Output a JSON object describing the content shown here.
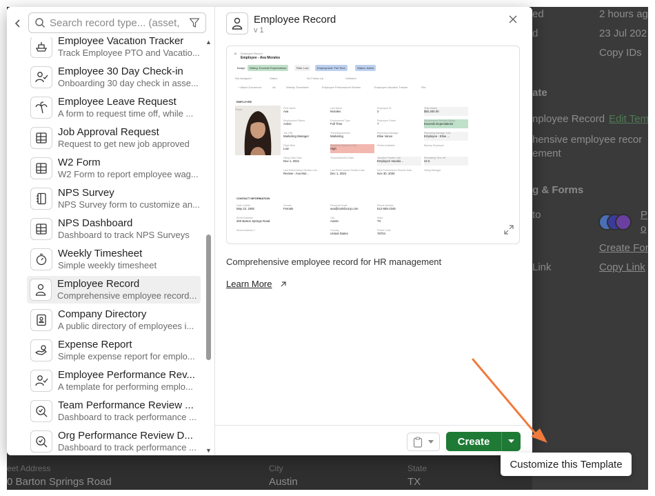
{
  "background": {
    "right_values": [
      "2 hours ag",
      "23 Jul 202",
      "Copy IDs"
    ],
    "left_fragments": [
      "ed",
      "d"
    ],
    "template_heading": "ate",
    "template_name": "nployee Record",
    "edit_link": "Edit Tem",
    "template_desc_line1": "hensive employee recor",
    "template_desc_line2": "ement",
    "section_heading": "g & Forms",
    "to_label": "to",
    "owner_link_p": "P",
    "owner_link_o": "o",
    "create_form_link": "Create For",
    "link_label": "Link",
    "copy_link": "Copy Link",
    "street_label": "eet Address",
    "street_value": "0 Barton Springs Road",
    "city_label": "City",
    "city_value": "Austin",
    "state_label": "State",
    "state_value": "TX",
    "avatar_colors": [
      "#4a6fb5",
      "#6b3fa0",
      "#3b3b9c"
    ]
  },
  "search": {
    "placeholder": "Search record type... (asset, p"
  },
  "templates": [
    {
      "name": "Employee Vacation Tracker",
      "desc": "Track Employee PTO and Vacatio...",
      "icon": "ship-icon"
    },
    {
      "name": "Employee 30 Day Check-in",
      "desc": "Onboarding 30 day check in asse...",
      "icon": "user-check-icon"
    },
    {
      "name": "Employee Leave Request",
      "desc": "A form to request time off, while ...",
      "icon": "palm-tree-icon"
    },
    {
      "name": "Job Approval Request",
      "desc": "Request to get new job approved",
      "icon": "table-grid-icon"
    },
    {
      "name": "W2 Form",
      "desc": "W2 Form to report employee wag...",
      "icon": "table-grid-icon"
    },
    {
      "name": "NPS Survey",
      "desc": "NPS Survey form to customize an...",
      "icon": "notebook-icon"
    },
    {
      "name": "NPS Dashboard",
      "desc": "Dashboard to track NPS Surveys",
      "icon": "table-grid-icon"
    },
    {
      "name": "Weekly Timesheet",
      "desc": "Simple weekly timesheet",
      "icon": "timer-icon"
    },
    {
      "name": "Employee Record",
      "desc": "Comprehensive employee record...",
      "icon": "user-icon"
    },
    {
      "name": "Company Directory",
      "desc": "A public directory of employees i...",
      "icon": "contact-book-icon"
    },
    {
      "name": "Expense Report",
      "desc": "Simple expense report for emplo...",
      "icon": "hand-coins-icon"
    },
    {
      "name": "Employee Performance Rev...",
      "desc": "A template for performing emplo...",
      "icon": "user-check-icon"
    },
    {
      "name": "Team Performance Review ...",
      "desc": "Dashboard to track performance ...",
      "icon": "search-check-icon"
    },
    {
      "name": "Org Performance Review D...",
      "desc": "Dashboard to track performance ...",
      "icon": "search-check-icon"
    }
  ],
  "selected_index": 8,
  "detail": {
    "title": "Employee Record",
    "version": "v 1",
    "description": "Comprehensive employee record for HR management",
    "learn_more": "Learn More"
  },
  "preview": {
    "crumb": "Employee Record",
    "title": "Employee - Ava Morales",
    "tags": [
      {
        "text": "Badge",
        "bg": "#ffffff"
      },
      {
        "text": "Rating: Exceeds Expectations",
        "bg": "#bfe0c9"
      },
      {
        "text": "Risk: Low",
        "bg": "#f1f1f1"
      },
      {
        "text": "Employment: Full Time",
        "bg": "#bcd0f0"
      },
      {
        "text": "Status: Active",
        "bg": "#bcd0f0"
      }
    ],
    "sub1": [
      "Not Assigned",
      "Status",
      "No Follow Up",
      "Unlinked"
    ],
    "sub2": [
      "+ Attach Document",
      "All",
      "Weekly Timesheet",
      "Employee Performance Review",
      "Employee Vacation Tracker",
      "File"
    ],
    "section1": "EMPLOYEE",
    "photo_label": "Photo",
    "fields": [
      {
        "l": "First Name",
        "v": "Ava"
      },
      {
        "l": "Last Name",
        "v": "Morales"
      },
      {
        "l": "Employee ID",
        "v": "2"
      },
      {
        "l": "Total Salary",
        "v": "$92,400.00"
      },
      {
        "l": "Employment Status",
        "v": "Active"
      },
      {
        "l": "Employment Type",
        "v": "Full Time"
      },
      {
        "l": "Employee Grade",
        "v": "7"
      },
      {
        "l": "Performance Review Rating",
        "v": "Exceeds Expectations"
      },
      {
        "l": "Job Title",
        "v": "Marketing Manager"
      },
      {
        "l": "Team/Department",
        "v": "Marketing"
      },
      {
        "l": "Reporting Manager",
        "v": "Elise Vance"
      },
      {
        "l": "Reporting Manager Link",
        "v": "Employee - Elise ..."
      },
      {
        "l": "Flight Risk",
        "v": "Low"
      },
      {
        "l": "Business Impact on Exit",
        "v": "High"
      },
      {
        "l": "Rehire Available",
        "v": ""
      },
      {
        "l": "Backup Employee",
        "v": ""
      },
      {
        "l": "Hiring Start Date",
        "v": "Nov 1, 2021"
      },
      {
        "l": "Termination/Exit Date",
        "v": ""
      },
      {
        "l": "Vacation Tracker Link",
        "v": "Employee Vacatio..."
      },
      {
        "l": "Remaining Time off",
        "v": "22.5"
      },
      {
        "l": "Last Performance Review Link",
        "v": "Review - Ava Mor..."
      },
      {
        "l": "Last Performance Review Date",
        "v": "Dec 1, 2024"
      },
      {
        "l": "Next Performance Review Date",
        "v": "Nov 30, 2025"
      },
      {
        "l": "Hiring Manager",
        "v": ""
      }
    ],
    "section2": "CONTACT INFORMATION",
    "contact": [
      {
        "l": "Date of Birth",
        "v": "May 22, 1992"
      },
      {
        "l": "Gender",
        "v": "Female"
      },
      {
        "l": "Personal Email",
        "v": "ava@toolsbcorp.com"
      },
      {
        "l": "Phone Number",
        "v": "512-555-2345"
      },
      {
        "l": "Street Address",
        "v": "200 Barton Springs Road"
      },
      {
        "l": "",
        "v": ""
      },
      {
        "l": "City",
        "v": "Austin"
      },
      {
        "l": "State",
        "v": "TX"
      },
      {
        "l": "Street Address 2",
        "v": ""
      },
      {
        "l": "",
        "v": ""
      },
      {
        "l": "Country",
        "v": "United States"
      },
      {
        "l": "Postal Code",
        "v": "78704"
      }
    ]
  },
  "footer": {
    "create_label": "Create"
  },
  "tooltip": {
    "text": "Customize this Template"
  },
  "colors": {
    "create_green": "#1f7a35",
    "arrow": "#f07a3c",
    "highlight_green": "#bfe0c9",
    "highlight_red": "#f2b7ae"
  }
}
